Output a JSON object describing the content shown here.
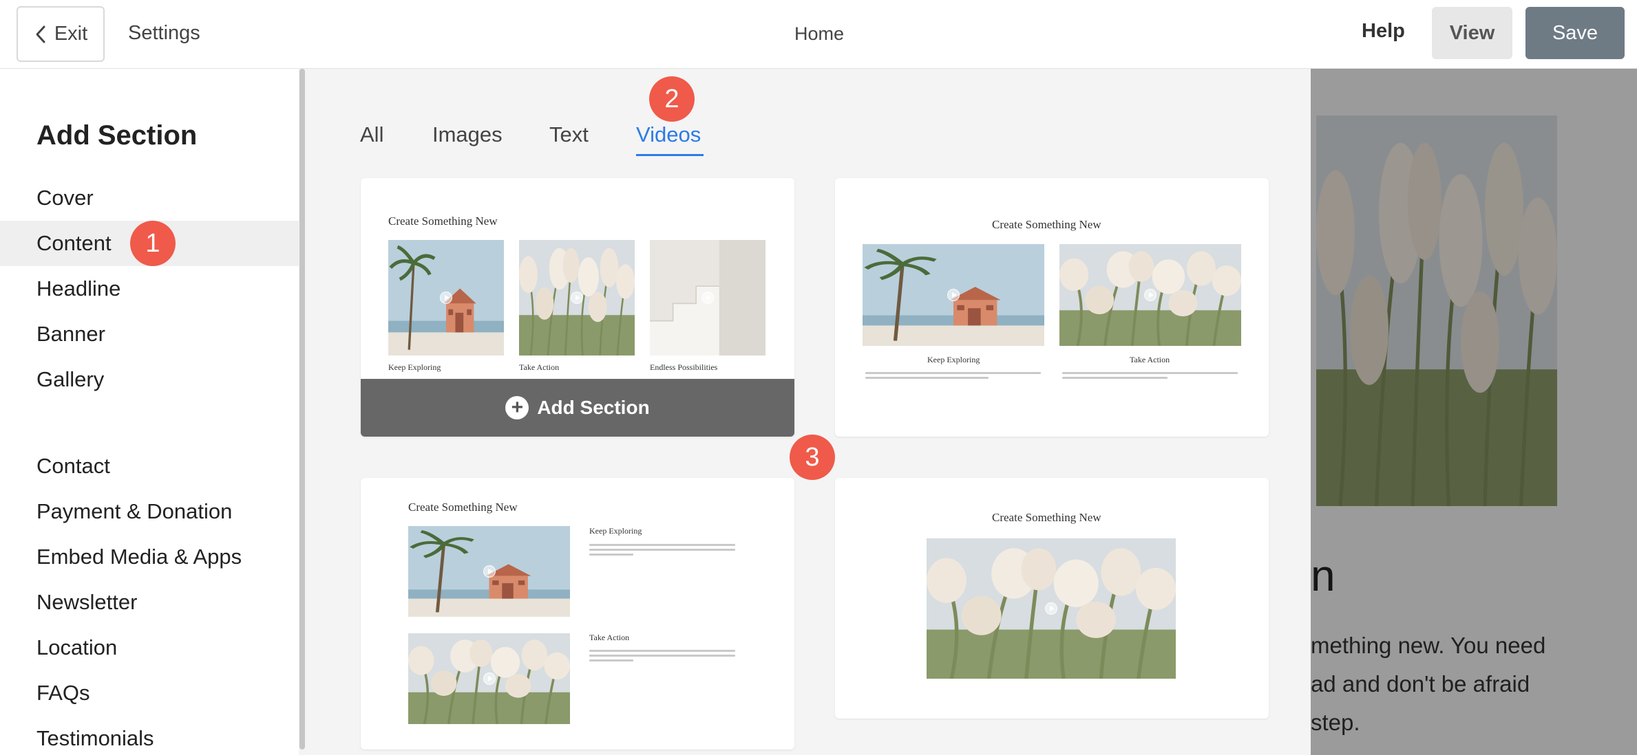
{
  "topbar": {
    "exit_label": "Exit",
    "settings_label": "Settings",
    "page_name": "Home",
    "help_label": "Help",
    "view_label": "View",
    "save_label": "Save"
  },
  "sidebar": {
    "title": "Add Section",
    "items": [
      {
        "label": "Cover"
      },
      {
        "label": "Content",
        "active": true
      },
      {
        "label": "Headline"
      },
      {
        "label": "Banner"
      },
      {
        "label": "Gallery"
      },
      {
        "label": "Contact"
      },
      {
        "label": "Payment & Donation"
      },
      {
        "label": "Embed Media & Apps"
      },
      {
        "label": "Newsletter"
      },
      {
        "label": "Location"
      },
      {
        "label": "FAQs"
      },
      {
        "label": "Testimonials"
      }
    ]
  },
  "tabs": [
    {
      "label": "All"
    },
    {
      "label": "Images"
    },
    {
      "label": "Text"
    },
    {
      "label": "Videos",
      "active": true
    }
  ],
  "templates": {
    "title": "Create Something New",
    "caption_1": "Keep Exploring",
    "caption_2": "Take Action",
    "caption_3": "Endless Possibilities",
    "add_section_label": "Add Section"
  },
  "preview": {
    "heading_fragment": "n",
    "line_1": "mething new. You need",
    "line_2": "ad and don't be afraid",
    "line_3": "step."
  },
  "badges": {
    "step_1": "1",
    "step_2": "2",
    "step_3": "3"
  },
  "colors": {
    "accent": "#2c7be5",
    "badge": "#f05a4a",
    "save_button": "#6e7b85"
  }
}
